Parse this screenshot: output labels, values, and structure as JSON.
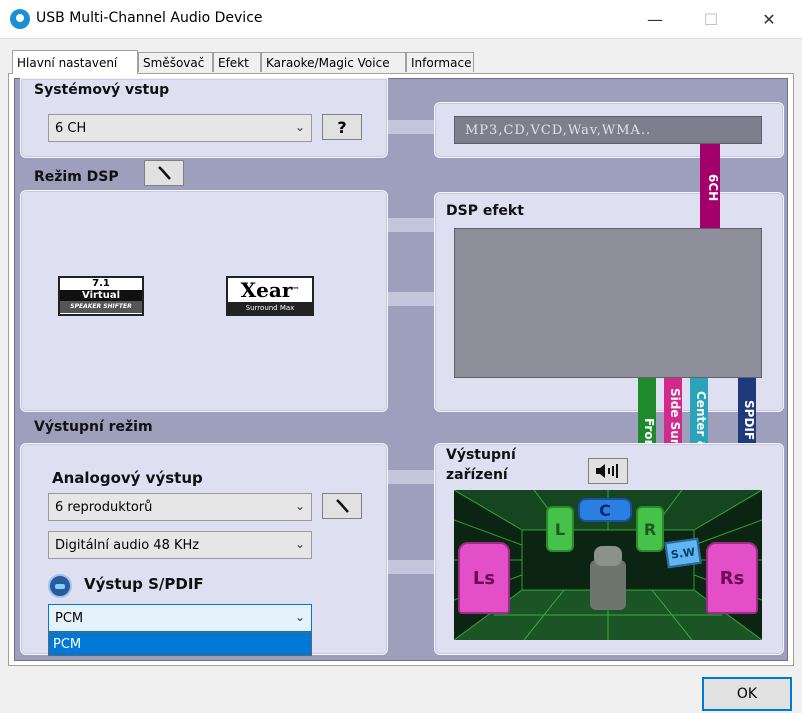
{
  "window": {
    "title": "USB Multi-Channel Audio Device",
    "minimize": "—",
    "maximize": "☐",
    "close": "✕"
  },
  "tabs": [
    "Hlavní nastavení",
    "Směšovač",
    "Efekt",
    "Karaoke/Magic Voice",
    "Informace"
  ],
  "system_input": {
    "label": "Systémový vstup",
    "value": "6 CH",
    "help": "?",
    "sources": "MP3,CD,VCD,Wav,WMA.."
  },
  "dsp_mode": {
    "label": "Režim DSP",
    "virtual_logo": {
      "top": "7.1",
      "mid": "Virtual",
      "bottom": "SPEAKER SHIFTER"
    },
    "xear_logo": {
      "main": "Xear",
      "tm": "™",
      "sub": "Surround Max"
    }
  },
  "dsp_effect": {
    "label": "DSP efekt",
    "channel_tag": "6CH"
  },
  "outputs": {
    "front": "Front",
    "side": "Side Surround",
    "center": "Center & Sub",
    "spdif": "SPDIF OUT"
  },
  "output_mode": {
    "label": "Výstupní režim",
    "analog_label": "Analogový výstup",
    "speakers": "6 reproduktorů",
    "digital": "Digitální audio 48 KHz",
    "spdif_label": "Výstup S/PDIF",
    "spdif_value": "PCM",
    "spdif_options": [
      "PCM"
    ]
  },
  "output_device": {
    "label_line1": "Výstupní",
    "label_line2": "zařízení",
    "speakers": {
      "l": "L",
      "c": "C",
      "r": "R",
      "sw": "S.W",
      "ls": "Ls",
      "rs": "Rs"
    }
  },
  "ok": "OK",
  "colors": {
    "front": "#1f8a2c",
    "side": "#d12a8c",
    "center": "#2aa3b8",
    "spdif": "#1f3a7a",
    "sixch": "#a3006b"
  }
}
